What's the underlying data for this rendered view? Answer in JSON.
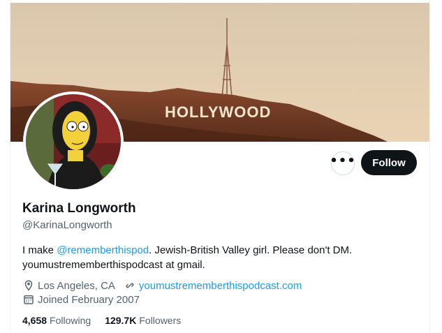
{
  "banner": {
    "sign_text": "HOLLYWOOD"
  },
  "profile": {
    "display_name": "Karina Longworth",
    "handle": "@KarinaLongworth",
    "bio_prefix": "I make ",
    "bio_mention": "@rememberthispod",
    "bio_suffix": ". Jewish-British Valley girl.  Please don't DM.",
    "bio_line2": "youmustrememberthispodcast at gmail.",
    "location": "Los Angeles, CA",
    "website": "youmustrememberthispodcast.com",
    "joined": "Joined February 2007",
    "following_count": "4,658",
    "following_label": "Following",
    "followers_count": "129.7K",
    "followers_label": "Followers"
  },
  "actions": {
    "more_label": "•••",
    "follow_label": "Follow"
  },
  "icons": {
    "more": "more-horizontal-icon",
    "location": "location-pin-icon",
    "link": "link-icon",
    "calendar": "calendar-icon"
  },
  "colors": {
    "link": "#1d9bf0",
    "text": "#0f1419",
    "secondary": "#536471",
    "button": "#0f1419"
  }
}
